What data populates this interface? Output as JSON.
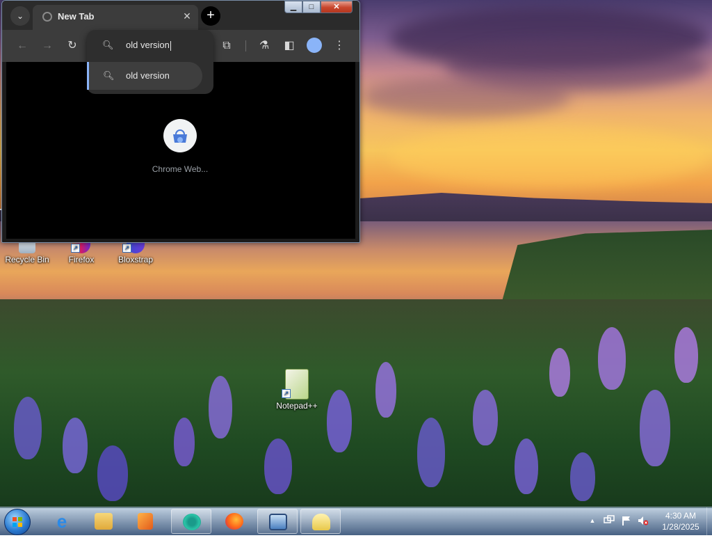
{
  "desktop": {
    "icons": [
      {
        "label": "Recycle Bin",
        "icon": "recycle-bin-icon"
      },
      {
        "label": "Firefox",
        "icon": "firefox-icon"
      },
      {
        "label": "Bloxstrap",
        "icon": "bloxstrap-icon"
      },
      {
        "label": "Notepad++",
        "icon": "notepadpp-icon"
      }
    ]
  },
  "browser": {
    "tab": {
      "title": "New Tab",
      "close_icon": "close-icon"
    },
    "caption": {
      "minimize": "▁",
      "maximize": "□",
      "close": "✕"
    },
    "toolbar": {
      "back": "←",
      "forward": "→",
      "reload": "↻",
      "extensions": "⧉",
      "labs": "⚗",
      "side_panel": "◧",
      "menu": "⋮"
    },
    "omnibox": {
      "input_value": "old version",
      "suggestions": [
        "old version"
      ]
    },
    "new_tab_page": {
      "shortcut_label": "Chrome Web..."
    }
  },
  "taskbar": {
    "apps": [
      {
        "name": "internet-explorer",
        "icon": "ie-icon"
      },
      {
        "name": "file-explorer",
        "icon": "folder-icon"
      },
      {
        "name": "media-player",
        "icon": "media-player-icon"
      },
      {
        "name": "chrome-beta",
        "icon": "chrome-icon",
        "active": true
      },
      {
        "name": "firefox",
        "icon": "firefox-icon"
      },
      {
        "name": "remote-desktop",
        "icon": "monitor-icon",
        "active": true
      },
      {
        "name": "network-app",
        "icon": "network-icon",
        "active": true
      }
    ],
    "tray": {
      "time": "4:30 AM",
      "date": "1/28/2025",
      "show_hidden": "▲"
    }
  },
  "colors": {
    "browser_bg": "#000000",
    "toolbar": "#3c3c3c",
    "accent": "#8ab4f8",
    "close_button": "#c8452c"
  }
}
